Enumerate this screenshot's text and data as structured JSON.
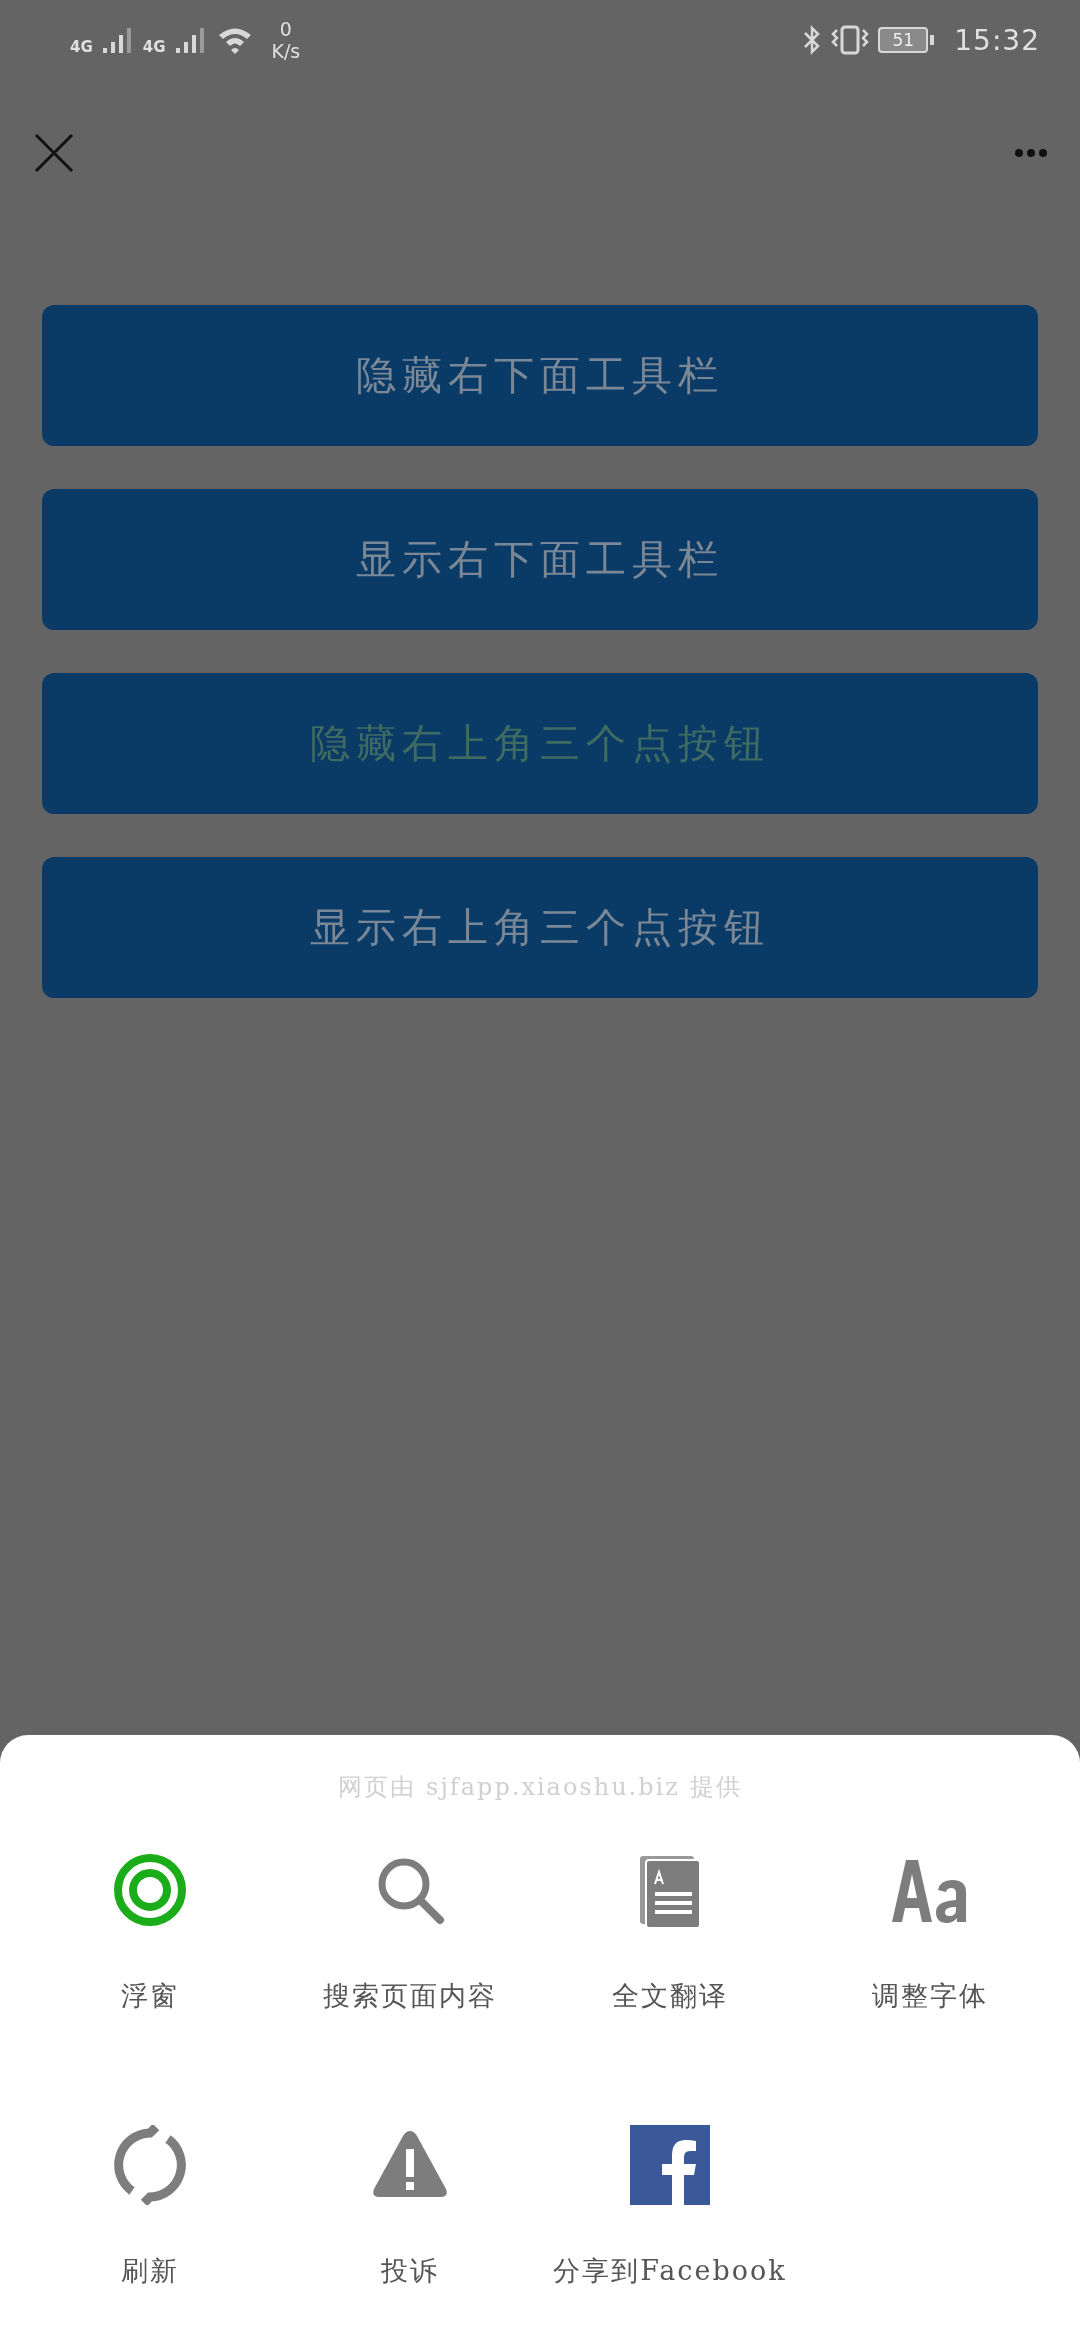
{
  "status_bar": {
    "network_1": "4G",
    "network_2": "4G",
    "speed_value": "0",
    "speed_unit": "K/s",
    "battery": "51",
    "time": "15:32"
  },
  "buttons": [
    {
      "label": "隐藏右下面工具栏",
      "pressed": false
    },
    {
      "label": "显示右下面工具栏",
      "pressed": false
    },
    {
      "label": "隐藏右上角三个点按钮",
      "pressed": true
    },
    {
      "label": "显示右上角三个点按钮",
      "pressed": false
    }
  ],
  "share_sheet": {
    "provider": "网页由 sjfapp.xiaoshu.biz 提供",
    "items": [
      {
        "kind": "float",
        "label": "浮窗"
      },
      {
        "kind": "search",
        "label": "搜索页面内容"
      },
      {
        "kind": "translate",
        "label": "全文翻译"
      },
      {
        "kind": "font",
        "label": "调整字体"
      },
      {
        "kind": "refresh",
        "label": "刷新"
      },
      {
        "kind": "report",
        "label": "投诉"
      },
      {
        "kind": "facebook",
        "label": "分享到Facebook"
      }
    ]
  }
}
